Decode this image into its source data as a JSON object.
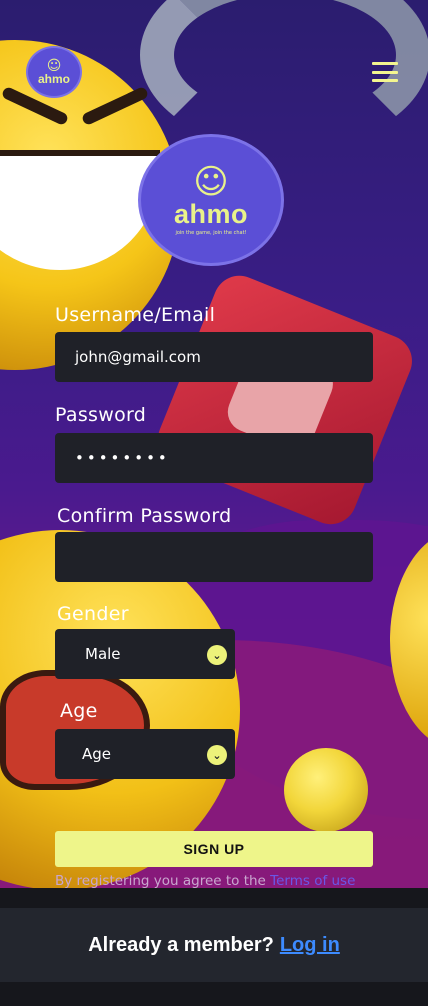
{
  "header": {
    "logo_text": "ahmo",
    "logo_glyph": "☺",
    "menu_icon": "hamburger-icon"
  },
  "brand": {
    "logo_text": "ahmo",
    "tagline": "join the game, join the chat!",
    "logo_glyph": "☺",
    "color_primary": "#5b4fd6",
    "color_accent": "#eef58a"
  },
  "form": {
    "username_label": "Username/Email",
    "username_value": "john@gmail.com",
    "password_label": "Password",
    "password_value": "••••••••",
    "confirm_label": "Confirm Password",
    "confirm_value": "",
    "gender_label": "Gender",
    "gender_value": "Male",
    "age_label": "Age",
    "age_value": "Age",
    "chevron": "⌄",
    "submit_label": "SIGN UP"
  },
  "terms": {
    "text": "By registering you agree to the ",
    "link_text": "Terms of use"
  },
  "footer": {
    "prompt": "Already a member?",
    "login_link": "Log in"
  }
}
